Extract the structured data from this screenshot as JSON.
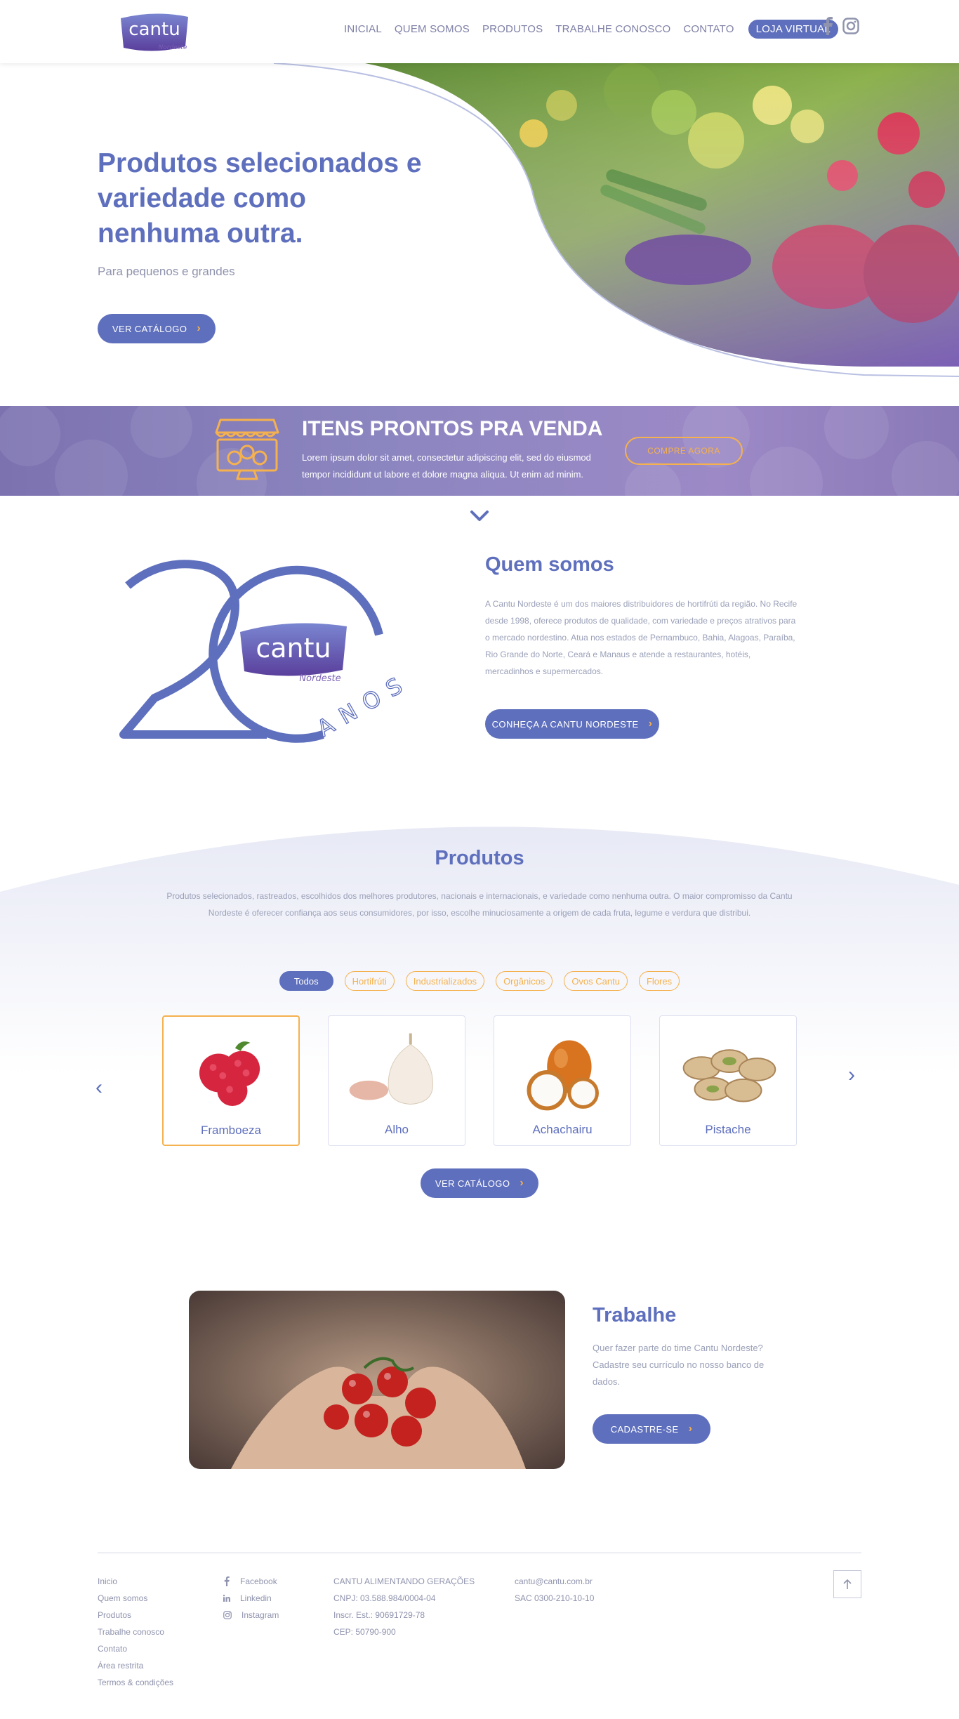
{
  "brand": {
    "logo_text": "cantu",
    "logo_sub": "Nordeste"
  },
  "nav": {
    "items": [
      "INICIAL",
      "QUEM SOMOS",
      "PRODUTOS",
      "TRABALHE CONOSCO",
      "CONTATO"
    ],
    "store": "LOJA VIRTUAL"
  },
  "hero": {
    "title": "Produtos selecionados e variedade como nenhuma outra.",
    "subtitle": "Para pequenos e grandes",
    "button": "VER CATÁLOGO"
  },
  "banner": {
    "title": "ITENS PRONTOS PRA VENDA",
    "text": "Lorem ipsum dolor sit amet, consectetur adipiscing elit, sed do eiusmod tempor incididunt ut labore et dolore magna aliqua. Ut enim ad minim.",
    "button": "COMPRE AGORA"
  },
  "about": {
    "badge_number": "20",
    "badge_word": "ANOS",
    "title": "Quem somos",
    "text": "A Cantu Nordeste é um dos maiores distribuidores de hortifrúti da região. No Recife desde 1998, oferece produtos de qualidade, com variedade e preços atrativos para o mercado nordestino. Atua nos estados de Pernambuco, Bahia, Alagoas, Paraíba, Rio Grande do Norte, Ceará e Manaus e atende a restaurantes, hotéis, mercadinhos e supermercados.",
    "button": "CONHEÇA A CANTU NORDESTE"
  },
  "products": {
    "title": "Produtos",
    "text": "Produtos selecionados, rastreados, escolhidos dos melhores produtores, nacionais e internacionais, e variedade como nenhuma outra. O maior compromisso da Cantu Nordeste é oferecer confiança aos seus consumidores, por isso, escolhe minuciosamente a origem de cada fruta, legume e verdura que distribui.",
    "filters": [
      "Todos",
      "Hortifrúti",
      "Industrializados",
      "Orgânicos",
      "Ovos Cantu",
      "Flores"
    ],
    "items": [
      "Framboeza",
      "Alho",
      "Achachairu",
      "Pistache"
    ],
    "button": "VER CATÁLOGO"
  },
  "work": {
    "title": "Trabalhe",
    "text": "Quer fazer parte do time Cantu Nordeste? Cadastre seu currículo no nosso banco de dados.",
    "button": "CADASTRE-SE"
  },
  "footer": {
    "links": [
      "Inicio",
      "Quem somos",
      "Produtos",
      "Trabalhe conosco",
      "Contato",
      "Área restrita",
      "Termos & condições"
    ],
    "social": [
      "Facebook",
      "Linkedin",
      "Instagram"
    ],
    "company": [
      "CANTU ALIMENTANDO GERAÇÕES",
      "CNPJ: 03.588.984/0004-04",
      "Inscr. Est.: 90691729-78",
      "CEP: 50790-900"
    ],
    "contact": [
      "cantu@cantu.com.br",
      "SAC 0300-210-10-10"
    ]
  },
  "colors": {
    "primary": "#5e6fbd",
    "accent": "#f5b14e",
    "text_muted": "#9aa0b8"
  }
}
